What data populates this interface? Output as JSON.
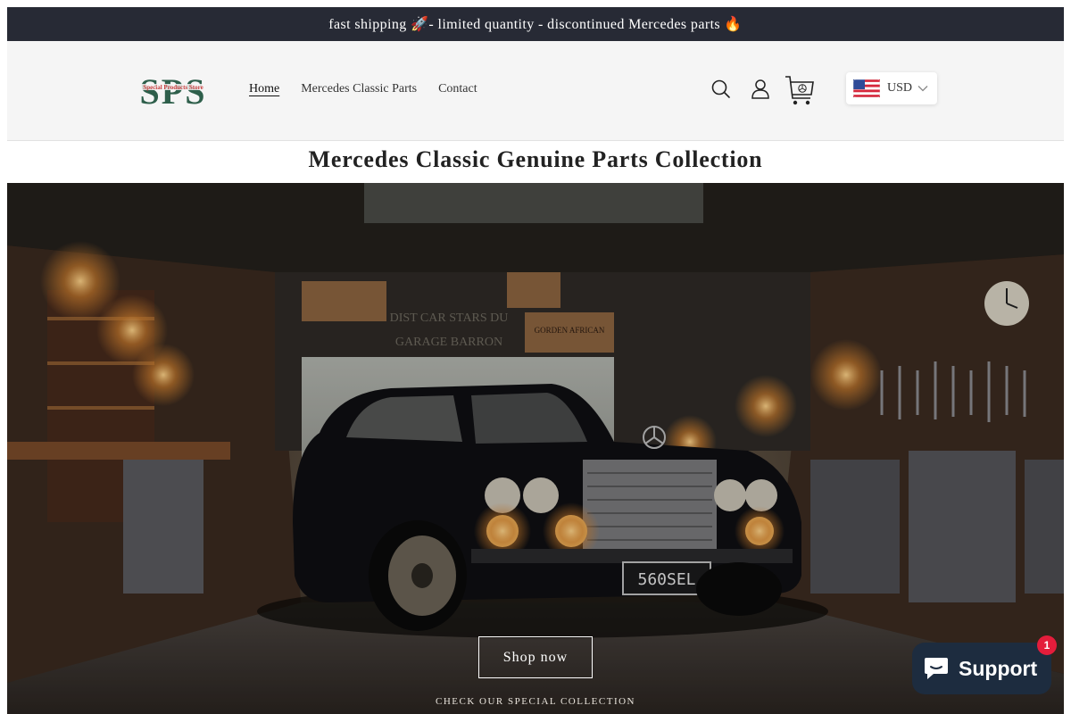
{
  "announcement": "fast shipping 🚀- limited quantity - discontinued Mercedes parts 🔥",
  "header": {
    "logo_text": "SPS",
    "logo_subtext": "Special Products Store",
    "nav": [
      {
        "label": "Home"
      },
      {
        "label": "Mercedes Classic Parts"
      },
      {
        "label": "Contact"
      }
    ],
    "currency": "USD"
  },
  "collection_title": "Mercedes Classic Genuine Parts Collection",
  "hero": {
    "plate": "560SEL",
    "sign_1": "DIST CAR STARS DU",
    "sign_2": "GARAGE BARRON",
    "sign_3": "GORDEN AFRICAN",
    "cta_label": "Shop now",
    "caption": "CHECK OUR SPECIAL COLLECTION"
  },
  "support": {
    "label": "Support",
    "badge": "1"
  },
  "colors": {
    "announcement_bg": "#272a35",
    "header_bg": "#f5f5f5",
    "support_bg": "#1d2c3f",
    "badge_red": "#e41d3b",
    "logo_green": "#2e5f4b",
    "logo_red": "#c53b3b"
  }
}
